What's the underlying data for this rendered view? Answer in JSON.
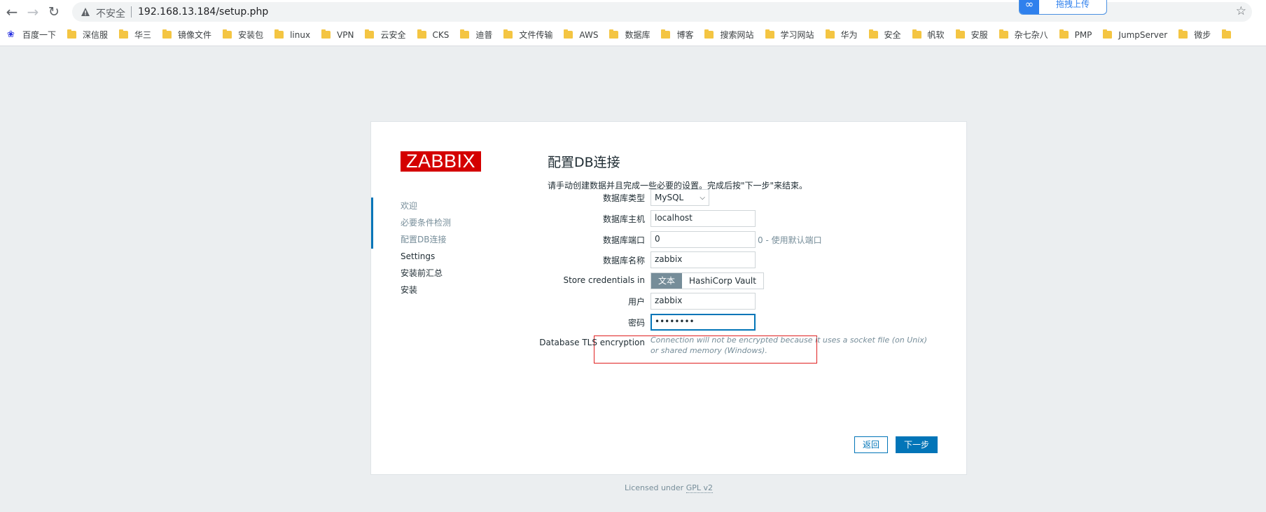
{
  "browser": {
    "insecure_label": "不安全",
    "url": "192.168.13.184/setup.php",
    "upload_label": "拖拽上传",
    "bookmarks": [
      "百度一下",
      "深信服",
      "华三",
      "镜像文件",
      "安装包",
      "linux",
      "VPN",
      "云安全",
      "CKS",
      "迪普",
      "文件传输",
      "AWS",
      "数据库",
      "博客",
      "搜索网站",
      "学习网站",
      "华为",
      "安全",
      "帆软",
      "安服",
      "杂七杂八",
      "PMP",
      "JumpServer",
      "微步"
    ]
  },
  "logo": "ZABBIX",
  "steps": [
    "欢迎",
    "必要条件检测",
    "配置DB连接",
    "Settings",
    "安装前汇总",
    "安装"
  ],
  "form": {
    "title": "配置DB连接",
    "description": "请手动创建数据并且完成一些必要的设置。完成后按\"下一步\"来结束。",
    "db_type_label": "数据库类型",
    "db_type_value": "MySQL",
    "db_host_label": "数据库主机",
    "db_host_value": "localhost",
    "db_port_label": "数据库端口",
    "db_port_value": "0",
    "db_port_hint": "0 - 使用默认端口",
    "db_name_label": "数据库名称",
    "db_name_value": "zabbix",
    "store_label": "Store credentials in",
    "store_options": [
      "文本",
      "HashiCorp Vault"
    ],
    "user_label": "用户",
    "user_value": "zabbix",
    "password_label": "密码",
    "password_value": "••••••••",
    "tls_label": "Database TLS encryption",
    "tls_note": "Connection will not be encrypted because it uses a socket file (on Unix) or shared memory (Windows)."
  },
  "buttons": {
    "back": "返回",
    "next": "下一步"
  },
  "footer": {
    "prefix": "Licensed under",
    "link": "GPL v2"
  }
}
